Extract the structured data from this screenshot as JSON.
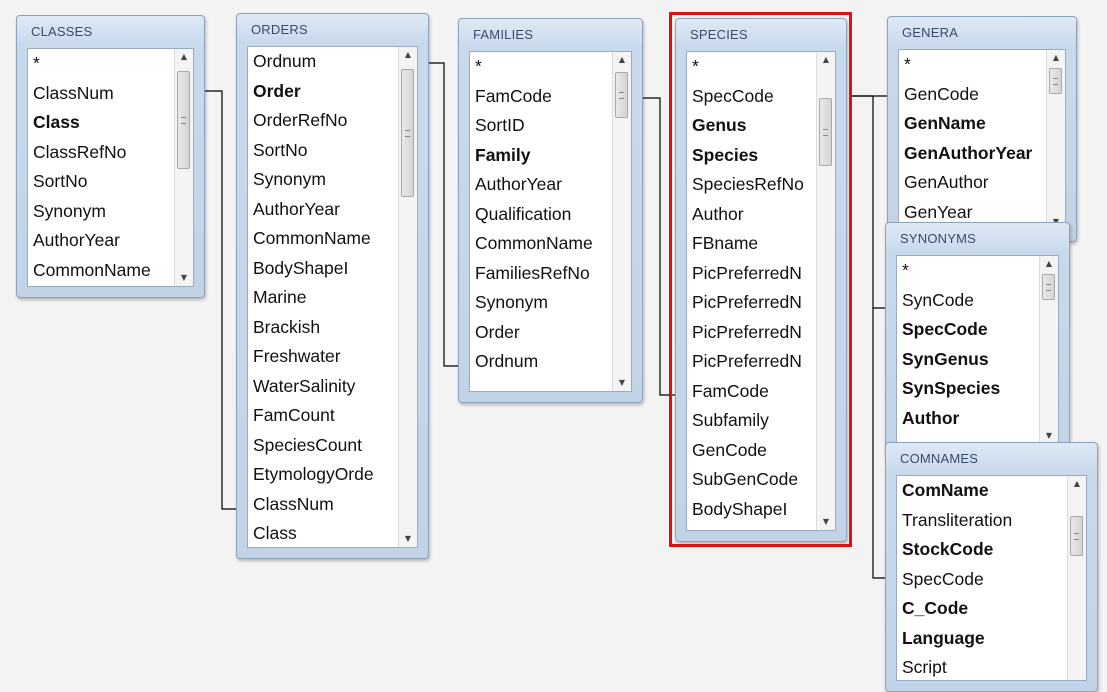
{
  "tables": {
    "classes": {
      "title": "CLASSES",
      "fields": [
        {
          "name": "*",
          "key": false
        },
        {
          "name": "ClassNum",
          "key": false
        },
        {
          "name": "Class",
          "key": true
        },
        {
          "name": "ClassRefNo",
          "key": false
        },
        {
          "name": "SortNo",
          "key": false
        },
        {
          "name": "Synonym",
          "key": false
        },
        {
          "name": "AuthorYear",
          "key": false
        },
        {
          "name": "CommonName",
          "key": false
        }
      ]
    },
    "orders": {
      "title": "ORDERS",
      "fields": [
        {
          "name": "Ordnum",
          "key": false
        },
        {
          "name": "Order",
          "key": true
        },
        {
          "name": "OrderRefNo",
          "key": false
        },
        {
          "name": "SortNo",
          "key": false
        },
        {
          "name": "Synonym",
          "key": false
        },
        {
          "name": "AuthorYear",
          "key": false
        },
        {
          "name": "CommonName",
          "key": false
        },
        {
          "name": "BodyShapeI",
          "key": false
        },
        {
          "name": "Marine",
          "key": false
        },
        {
          "name": "Brackish",
          "key": false
        },
        {
          "name": "Freshwater",
          "key": false
        },
        {
          "name": "WaterSalinity",
          "key": false
        },
        {
          "name": "FamCount",
          "key": false
        },
        {
          "name": "SpeciesCount",
          "key": false
        },
        {
          "name": "EtymologyOrde",
          "key": false
        },
        {
          "name": "ClassNum",
          "key": false
        },
        {
          "name": "Class",
          "key": false
        }
      ]
    },
    "families": {
      "title": "FAMILIES",
      "fields": [
        {
          "name": "*",
          "key": false
        },
        {
          "name": "FamCode",
          "key": false
        },
        {
          "name": "SortID",
          "key": false
        },
        {
          "name": "Family",
          "key": true
        },
        {
          "name": "AuthorYear",
          "key": false
        },
        {
          "name": "Qualification",
          "key": false
        },
        {
          "name": "CommonName",
          "key": false
        },
        {
          "name": "FamiliesRefNo",
          "key": false
        },
        {
          "name": "Synonym",
          "key": false
        },
        {
          "name": "Order",
          "key": false
        },
        {
          "name": "Ordnum",
          "key": false
        }
      ]
    },
    "species": {
      "title": "SPECIES",
      "fields": [
        {
          "name": "*",
          "key": false
        },
        {
          "name": "SpecCode",
          "key": false
        },
        {
          "name": "Genus",
          "key": true
        },
        {
          "name": "Species",
          "key": true
        },
        {
          "name": "SpeciesRefNo",
          "key": false
        },
        {
          "name": "Author",
          "key": false
        },
        {
          "name": "FBname",
          "key": false
        },
        {
          "name": "PicPreferredN",
          "key": false
        },
        {
          "name": "PicPreferredN",
          "key": false
        },
        {
          "name": "PicPreferredN",
          "key": false
        },
        {
          "name": "PicPreferredN",
          "key": false
        },
        {
          "name": "FamCode",
          "key": false
        },
        {
          "name": "Subfamily",
          "key": false
        },
        {
          "name": "GenCode",
          "key": false
        },
        {
          "name": "SubGenCode",
          "key": false
        },
        {
          "name": "BodyShapeI",
          "key": false
        }
      ]
    },
    "genera": {
      "title": "GENERA",
      "fields": [
        {
          "name": "*",
          "key": false
        },
        {
          "name": "GenCode",
          "key": false
        },
        {
          "name": "GenName",
          "key": true
        },
        {
          "name": "GenAuthorYear",
          "key": true
        },
        {
          "name": "GenAuthor",
          "key": false
        },
        {
          "name": "GenYear",
          "key": false
        }
      ]
    },
    "synonyms": {
      "title": "SYNONYMS",
      "fields": [
        {
          "name": "*",
          "key": false
        },
        {
          "name": "SynCode",
          "key": false
        },
        {
          "name": "SpecCode",
          "key": true
        },
        {
          "name": "SynGenus",
          "key": true
        },
        {
          "name": "SynSpecies",
          "key": true
        },
        {
          "name": "Author",
          "key": true
        }
      ]
    },
    "comnames": {
      "title": "COMNAMES",
      "fields": [
        {
          "name": "ComName",
          "key": true
        },
        {
          "name": "Transliteration",
          "key": false
        },
        {
          "name": "StockCode",
          "key": true
        },
        {
          "name": "SpecCode",
          "key": false
        },
        {
          "name": "C_Code",
          "key": true
        },
        {
          "name": "Language",
          "key": true
        },
        {
          "name": "Script",
          "key": false
        }
      ]
    }
  },
  "colors": {
    "highlight": "#e01010",
    "title_bar": "#c9d9ec",
    "line": "#000000"
  },
  "icons": {
    "scroll_up": "scroll-up-arrow-icon",
    "scroll_down": "scroll-down-arrow-icon"
  }
}
